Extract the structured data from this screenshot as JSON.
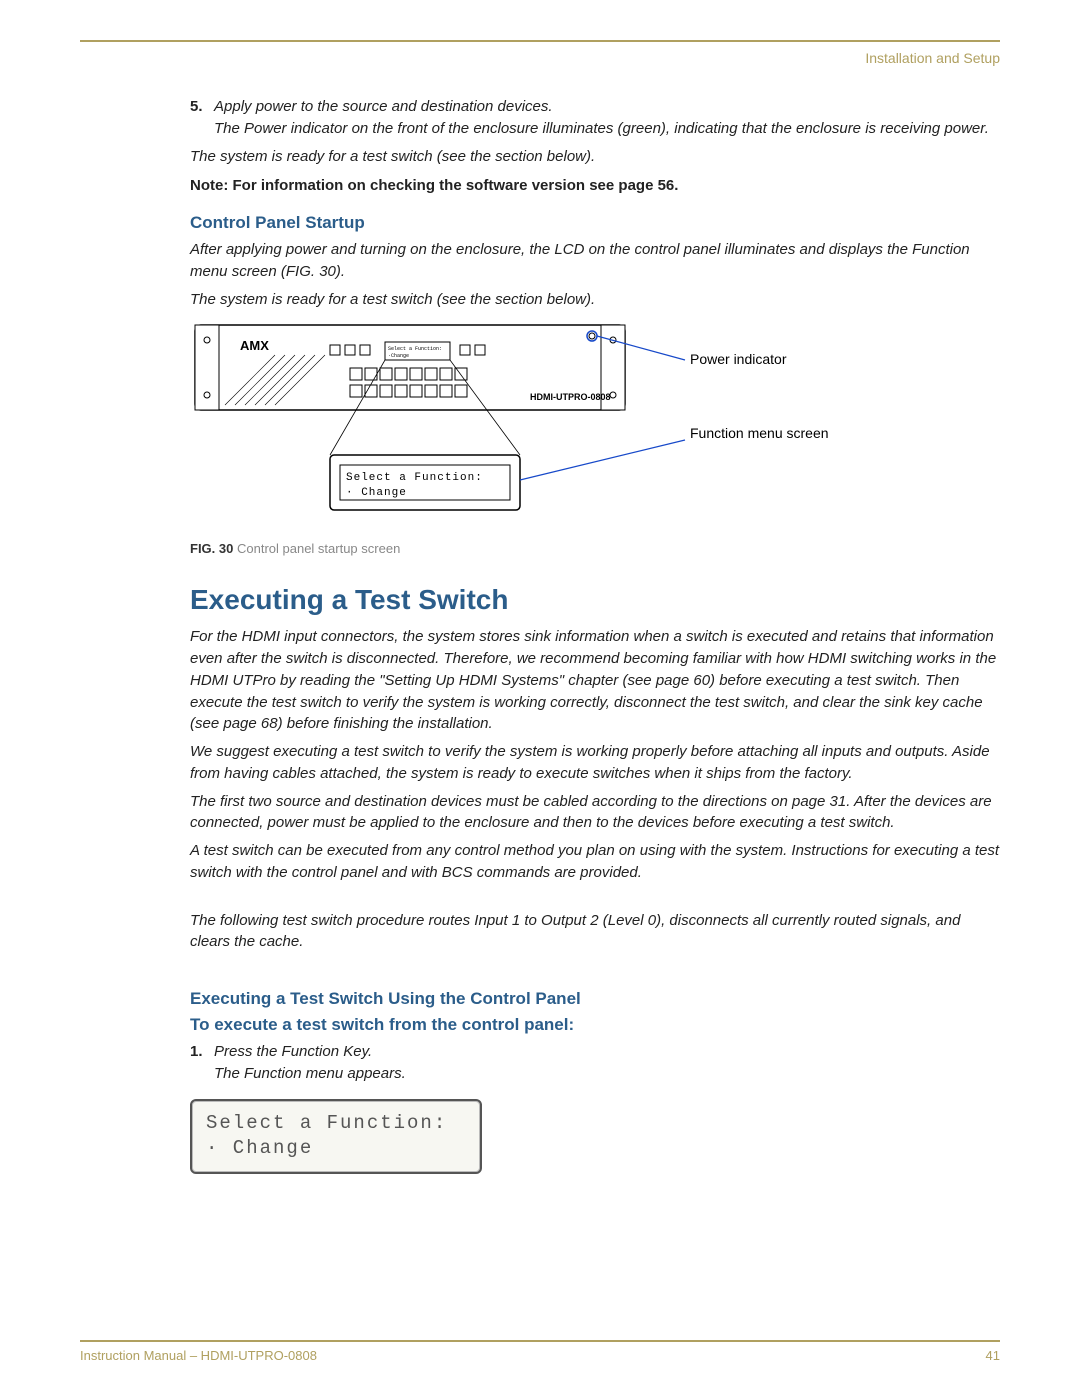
{
  "header": {
    "section": "Installation and Setup"
  },
  "step5": {
    "num": "5.",
    "line1": "Apply power to the source and destination devices.",
    "line2": "The Power indicator on the front of the enclosure illuminates (green), indicating that the enclosure is receiving power."
  },
  "ready1": "The system is ready for a test switch (see the section below).",
  "note": "Note: For information on checking the software version see page 56.",
  "cps": {
    "title": "Control Panel Startup",
    "p1": "After applying power and turning on the enclosure, the LCD on the control panel illuminates and displays the Function menu screen (FIG. 30).",
    "p2": "The system is ready for a test switch (see the section below)."
  },
  "fig30": {
    "label": "FIG. 30",
    "caption": "Control panel startup screen",
    "callout_power": "Power indicator",
    "callout_function": "Function menu screen",
    "device_label": "HDMI-UTPRO-0808",
    "brand": "AMX",
    "lcd_line1": "Select a Function:",
    "lcd_line2": "· Change"
  },
  "exec": {
    "title": "Executing a Test Switch",
    "p1": "For the HDMI input connectors, the system stores sink information when a switch is executed and retains that information even after the switch is disconnected. Therefore, we recommend becoming familiar with how HDMI switching works in the HDMI UTPro by reading the \"Setting Up HDMI Systems\" chapter (see page 60) before executing a test switch. Then execute the test switch to verify the system is working correctly, disconnect the test switch, and clear the sink key cache (see page 68) before finishing the installation.",
    "p2": "We suggest executing a test switch to verify the system is working properly before attaching all inputs and outputs. Aside from having cables attached, the system is ready to execute switches when it ships from the factory.",
    "p3": "The first two source and destination devices must be cabled according to the directions on page 31. After the devices are connected, power must be applied to the enclosure and then to the devices before executing a test switch.",
    "p4": "A test switch can be executed from any control method you plan on using with the system. Instructions for executing a test switch with the control panel and with BCS commands are provided.",
    "p5": "The following test switch procedure routes Input 1 to Output 2 (Level 0), disconnects all currently routed signals, and clears the cache."
  },
  "exec_cp": {
    "h2a": "Executing a Test Switch Using the Control Panel",
    "h2b": "To execute a test switch from the control panel:",
    "step1_num": "1.",
    "step1_a": "Press the Function Key.",
    "step1_b": "The Function menu appears."
  },
  "lcd": {
    "line1": "Select a Function:",
    "line2": "· Change"
  },
  "footer": {
    "left": "Instruction Manual – HDMI-UTPRO-0808",
    "right": "41"
  }
}
